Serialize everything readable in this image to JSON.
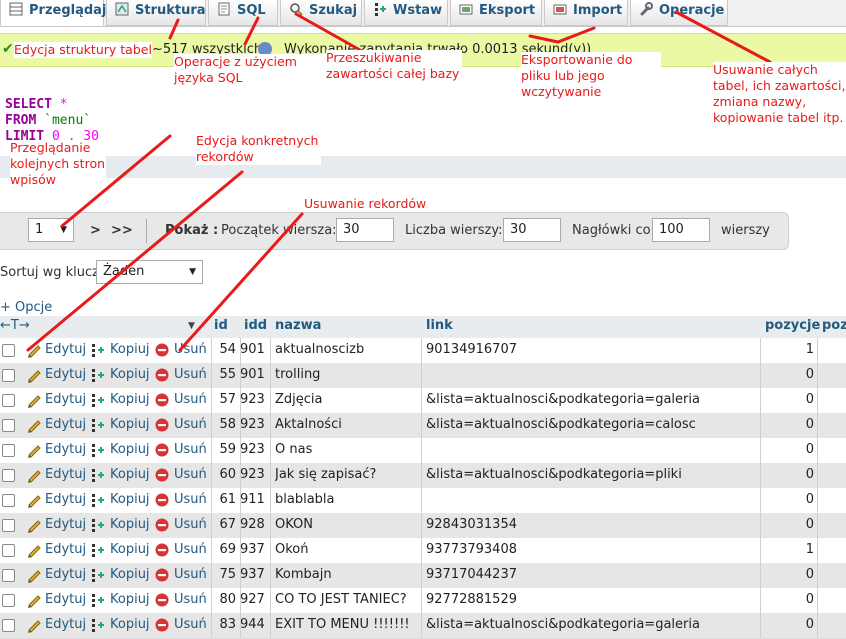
{
  "tabs": [
    {
      "label": "Przeglądaj",
      "icon": "browse-icon",
      "active": true
    },
    {
      "label": "Struktura",
      "icon": "structure-icon"
    },
    {
      "label": "SQL",
      "icon": "sql-icon"
    },
    {
      "label": "Szukaj",
      "icon": "search-icon"
    },
    {
      "label": "Wstaw",
      "icon": "insert-icon"
    },
    {
      "label": "Eksport",
      "icon": "export-icon"
    },
    {
      "label": "Import",
      "icon": "import-icon"
    },
    {
      "label": "Operacje",
      "icon": "wrench-icon"
    }
  ],
  "success": {
    "text_a": "~517 wszystkich",
    "text_b": "Wykonanie zapytania trwało 0.0013 sekund(y))"
  },
  "sql": {
    "select": "SELECT",
    "star": "*",
    "from": "FROM",
    "table": "`menu`",
    "limit": "LIMIT",
    "limit_vals": "0 , 30"
  },
  "nav": {
    "page": "1",
    "next": ">",
    "last": ">>",
    "show_label": "Pokaż :",
    "start_label": "Początek wiersza:",
    "start_value": "30",
    "rows_label": "Liczba wierszy:",
    "rows_value": "30",
    "headers_label": "Nagłówki co",
    "headers_value": "100",
    "rows_suffix": "wierszy"
  },
  "sort": {
    "label": "Sortuj wg klucza:",
    "value": "Żaden"
  },
  "options_label": "+ Opcje",
  "table": {
    "headers": [
      "id",
      "idd",
      "nazwa",
      "link",
      "pozycje",
      "pozy"
    ],
    "actions": {
      "edit": "Edytuj",
      "copy": "Kopiuj",
      "delete": "Usuń"
    },
    "rows": [
      {
        "id": "54",
        "idd": "901",
        "nazwa": "aktualnoscizb",
        "link": "90134916707",
        "pozycje": "1"
      },
      {
        "id": "55",
        "idd": "901",
        "nazwa": "trolling",
        "link": "",
        "pozycje": "0"
      },
      {
        "id": "57",
        "idd": "923",
        "nazwa": "Zdjęcia",
        "link": "&lista=aktualnosci&podkategoria=galeria",
        "pozycje": "0"
      },
      {
        "id": "58",
        "idd": "923",
        "nazwa": "Aktalności",
        "link": "&lista=aktualnosci&podkategoria=calosc",
        "pozycje": "0"
      },
      {
        "id": "59",
        "idd": "923",
        "nazwa": "O nas",
        "link": "",
        "pozycje": "0"
      },
      {
        "id": "60",
        "idd": "923",
        "nazwa": "Jak się zapisać?",
        "link": "&lista=aktualnosci&podkategoria=pliki",
        "pozycje": "0"
      },
      {
        "id": "61",
        "idd": "911",
        "nazwa": "blablabla",
        "link": "",
        "pozycje": "0"
      },
      {
        "id": "67",
        "idd": "928",
        "nazwa": "OKON",
        "link": "92843031354",
        "pozycje": "0"
      },
      {
        "id": "69",
        "idd": "937",
        "nazwa": "Okoń",
        "link": "93773793408",
        "pozycje": "1"
      },
      {
        "id": "75",
        "idd": "937",
        "nazwa": "Kombajn",
        "link": "93717044237",
        "pozycje": "0"
      },
      {
        "id": "80",
        "idd": "927",
        "nazwa": "CO TO JEST TANIEC?",
        "link": "92772881529",
        "pozycje": "0"
      },
      {
        "id": "83",
        "idd": "944",
        "nazwa": "EXIT TO MENU !!!!!!!",
        "link": "&lista=aktualnosci&podkategoria=galeria",
        "pozycje": "0"
      }
    ]
  },
  "annotations": {
    "edit_structure": "Edycja struktury tabel",
    "sql_ops": "Operacje z użyciem języka SQL",
    "search_db": "Przeszukiwanie zawartości całej bazy",
    "export": "Eksportowanie do pliku lub jego wczytywanie",
    "operations": "Usuwanie całych tabel, ich zawartości, zmiana nazwy, kopiowanie tabel itp.",
    "paging": "Przeglądanie kolejnych stron wpisów",
    "edit_records": "Edycja konkretnych rekordów",
    "delete_records": "Usuwanie rekordów"
  },
  "colors": {
    "annotation": "#e81a1a",
    "link": "#235a81",
    "success_bg": "#ebf8a4",
    "sql_keyword": "#990099"
  }
}
